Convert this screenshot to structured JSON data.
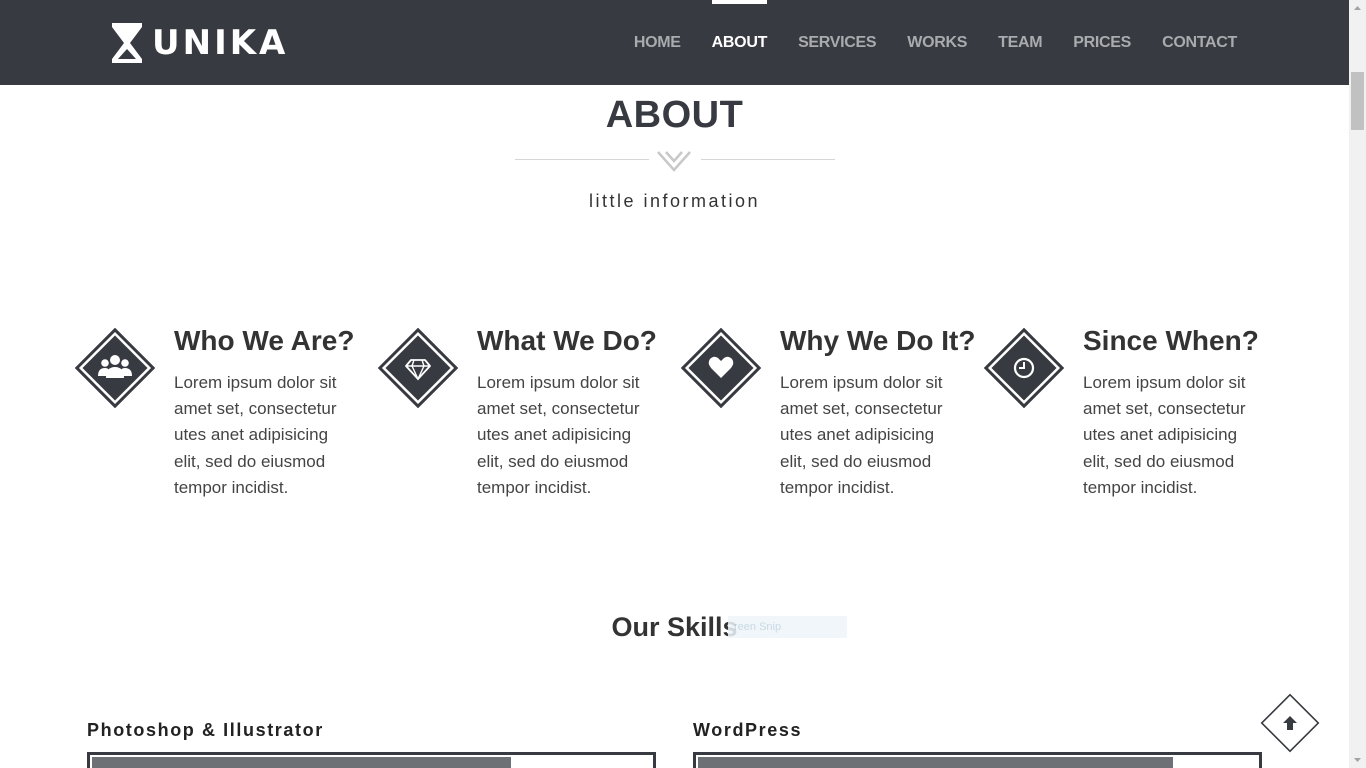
{
  "brand": {
    "name": "UNIKA"
  },
  "nav": {
    "items": [
      {
        "label": "HOME",
        "active": false
      },
      {
        "label": "ABOUT",
        "active": true
      },
      {
        "label": "SERVICES",
        "active": false
      },
      {
        "label": "WORKS",
        "active": false
      },
      {
        "label": "TEAM",
        "active": false
      },
      {
        "label": "PRICES",
        "active": false
      },
      {
        "label": "CONTACT",
        "active": false
      }
    ]
  },
  "about": {
    "title": "ABOUT",
    "divider_icon": "w-chevron-icon",
    "subtitle": "little information",
    "features": [
      {
        "icon": "users-icon",
        "title": "Who We Are?",
        "text": "Lorem ipsum dolor sit amet set, consectetur utes anet adipisicing elit, sed do eiusmod tempor incidist."
      },
      {
        "icon": "diamond-icon",
        "title": "What We Do?",
        "text": "Lorem ipsum dolor sit amet set, consectetur utes anet adipisicing elit, sed do eiusmod tempor incidist."
      },
      {
        "icon": "heart-icon",
        "title": "Why We Do It?",
        "text": "Lorem ipsum dolor sit amet set, consectetur utes anet adipisicing elit, sed do eiusmod tempor incidist."
      },
      {
        "icon": "clock-icon",
        "title": "Since When?",
        "text": "Lorem ipsum dolor sit amet set, consectetur utes anet adipisicing elit, sed do eiusmod tempor incidist."
      }
    ]
  },
  "skills": {
    "title": "Our Skills",
    "overlay_text": "reen Snip",
    "items": [
      {
        "label": "Photoshop & Illustrator",
        "level": 0.75
      },
      {
        "label": "WordPress",
        "level": 0.85
      }
    ]
  },
  "back_to_top": {
    "icon": "arrow-up-icon"
  },
  "colors": {
    "header_bg": "#373a40",
    "accent": "#373a40",
    "nav_inactive": "#a9abae",
    "nav_active": "#ffffff",
    "skill_fill": "#6d7075"
  }
}
